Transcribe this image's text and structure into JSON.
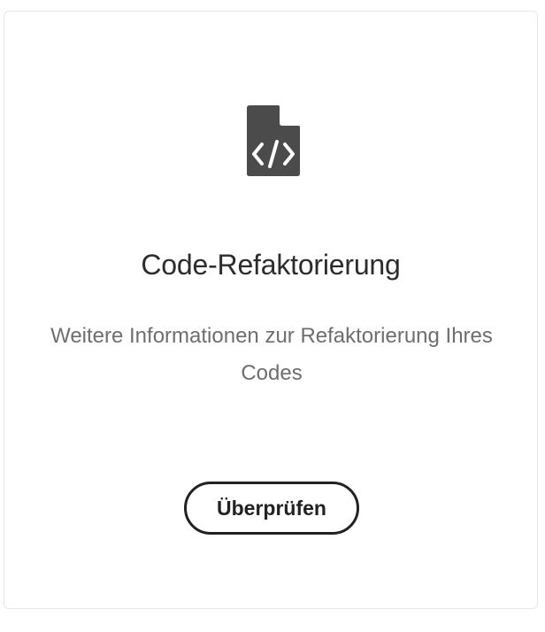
{
  "card": {
    "icon": "code-file-icon",
    "title": "Code-Refaktorierung",
    "description": "Weitere Informationen zur Refaktorierung Ihres Codes",
    "button_label": "Überprüfen"
  },
  "colors": {
    "icon": "#4b4b4b",
    "title": "#2c2c2c",
    "description": "#6e6e6e",
    "button_border": "#222222"
  }
}
